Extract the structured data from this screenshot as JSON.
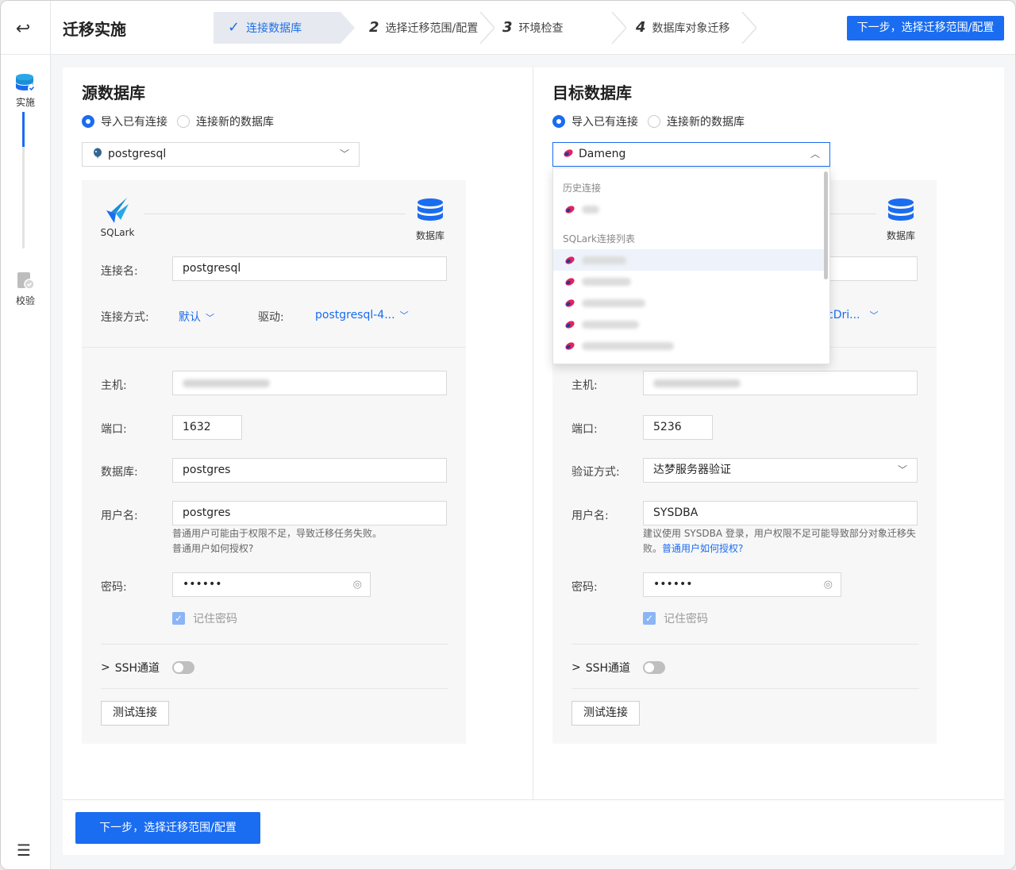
{
  "header": {
    "title": "迁移实施",
    "steps": [
      {
        "num": "✓",
        "label": "连接数据库"
      },
      {
        "num": "2",
        "label": "选择迁移范围/配置"
      },
      {
        "num": "3",
        "label": "环境检查"
      },
      {
        "num": "4",
        "label": "数据库对象迁移"
      }
    ],
    "next_label": "下一步，选择迁移范围/配置"
  },
  "sidebar": {
    "items": [
      {
        "label": "实施"
      },
      {
        "label": "校验"
      }
    ]
  },
  "source": {
    "title": "源数据库",
    "radio_existing": "导入已有连接",
    "radio_new": "连接新的数据库",
    "selected": "postgresql",
    "sqlark_label": "SQLark",
    "db_label": "数据库",
    "conn_name_label": "连接名:",
    "conn_name_value": "postgresql",
    "conn_mode_label": "连接方式:",
    "conn_mode_value": "默认",
    "driver_label": "驱动:",
    "driver_value": "postgresql-4...",
    "host_label": "主机:",
    "port_label": "端口:",
    "port_value": "1632",
    "database_label": "数据库:",
    "database_value": "postgres",
    "user_label": "用户名:",
    "user_value": "postgres",
    "user_hint": "普通用户可能由于权限不足，导致迁移任务失败。",
    "user_hint_link": "普通用户如何授权?",
    "password_label": "密码:",
    "password_value": "••••••",
    "remember_label": "记住密码",
    "ssh_label": "SSH通道",
    "test_label": "测试连接"
  },
  "target": {
    "title": "目标数据库",
    "radio_existing": "导入已有连接",
    "radio_new": "连接新的数据库",
    "selected": "Dameng",
    "db_label": "数据库",
    "driver_value_partial": "cDri...",
    "host_label": "主机:",
    "port_label": "端口:",
    "port_value": "5236",
    "auth_label": "验证方式:",
    "auth_value": "达梦服务器验证",
    "user_label": "用户名:",
    "user_value": "SYSDBA",
    "user_hint": "建议使用 SYSDBA 登录，用户权限不足可能导致部分对象迁移失",
    "user_hint2": "败。",
    "user_hint_link": "普通用户如何授权?",
    "password_label": "密码:",
    "password_value": "••••••",
    "remember_label": "记住密码",
    "ssh_label": "SSH通道",
    "test_label": "测试连接"
  },
  "dropdown": {
    "group_history": "历史连接",
    "group_sqlark": "SQLark连接列表"
  },
  "footer": {
    "next_label": "下一步，选择迁移范围/配置"
  },
  "colors": {
    "primary": "#1a6cf0",
    "step_active_bg": "#e6eaf0"
  }
}
